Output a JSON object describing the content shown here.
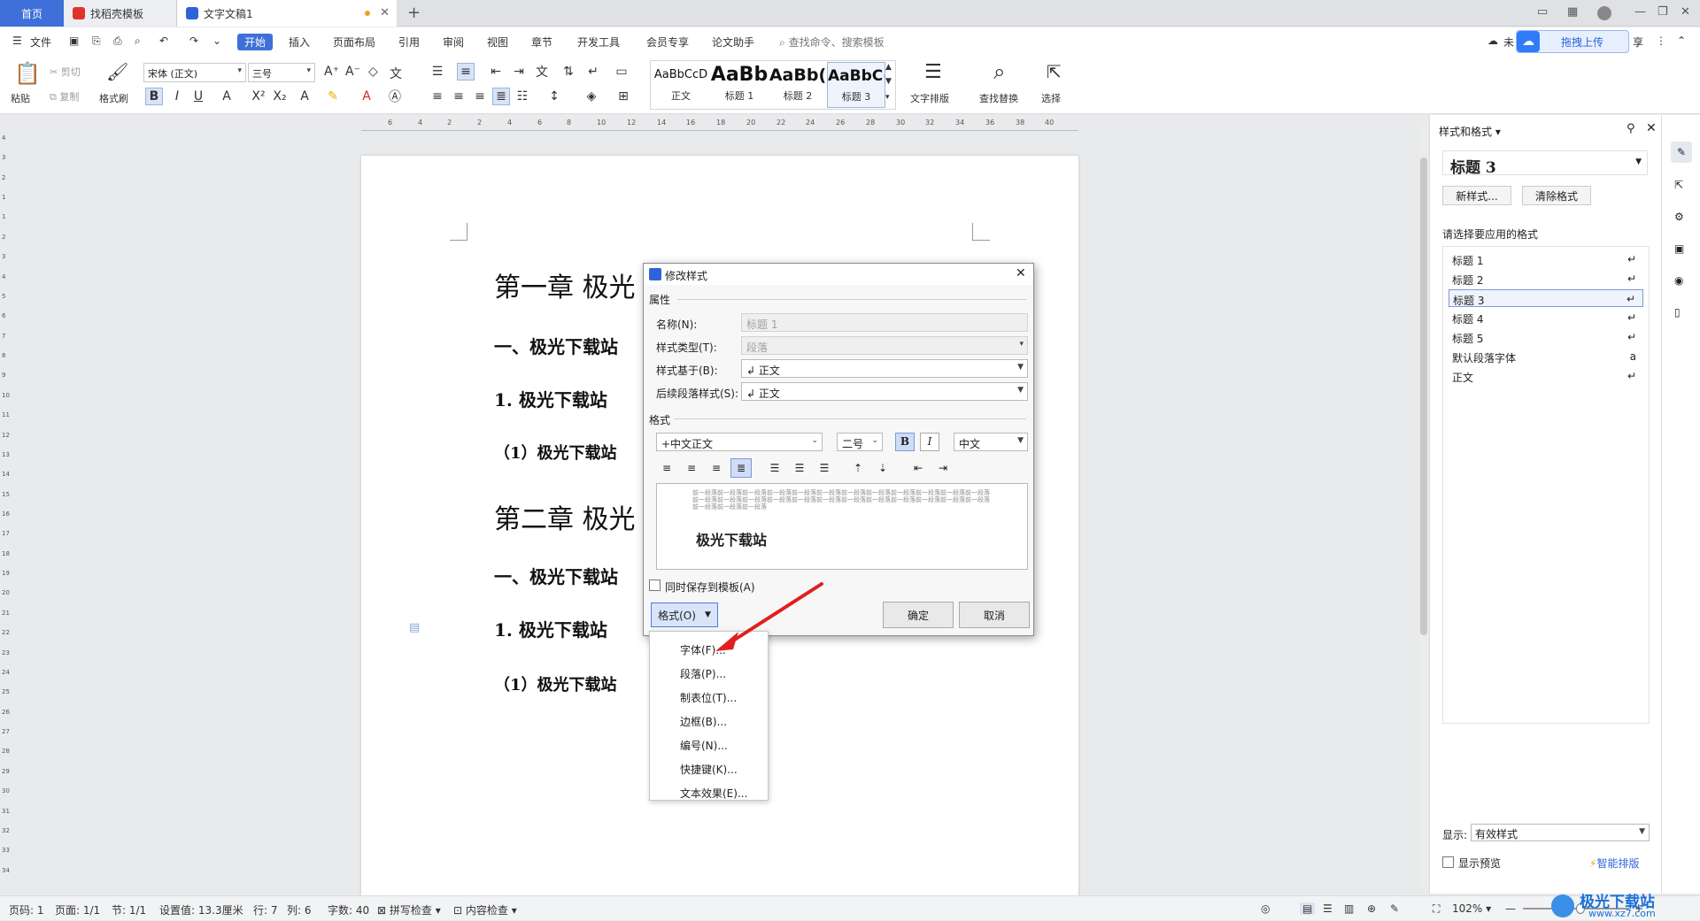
{
  "tabs": {
    "home": "首页",
    "template": "找稻壳模板",
    "document": "文字文稿1",
    "new_tab": "+"
  },
  "menubar": {
    "file": "文件",
    "items": [
      "开始",
      "插入",
      "页面布局",
      "引用",
      "审阅",
      "视图",
      "章节",
      "开发工具",
      "会员专享",
      "论文助手"
    ],
    "search_placeholder": "查找命令、搜索模板",
    "upload": "拖拽上传",
    "sync_partial": "未",
    "share_partial": "享"
  },
  "ribbon": {
    "paste": "粘贴",
    "cut": "剪切",
    "copy": "复制",
    "format_painter": "格式刷",
    "font_name": "宋体 (正文)",
    "font_size": "三号",
    "styles": [
      {
        "preview": "AaBbCcD",
        "label": "正文"
      },
      {
        "preview": "AaBb",
        "label": "标题 1"
      },
      {
        "preview": "AaBb(",
        "label": "标题 2"
      },
      {
        "preview": "AaBbC(",
        "label": "标题 3"
      }
    ],
    "text_layout": "文字排版",
    "find_replace": "查找替换",
    "select": "选择"
  },
  "document": {
    "lines": [
      "第一章  极光",
      "一、极光下载站",
      "1. 极光下载站",
      "（1）极光下载站",
      "第二章  极光",
      "一、极光下载站",
      "1. 极光下载站",
      "（1）极光下载站"
    ]
  },
  "dialog": {
    "title": "修改样式",
    "section_properties": "属性",
    "name_label": "名称(N):",
    "name_value": "标题 1",
    "type_label": "样式类型(T):",
    "type_value": "段落",
    "based_label": "样式基于(B):",
    "based_value": "↲ 正文",
    "next_label": "后续段落样式(S):",
    "next_value": "↲ 正文",
    "section_format": "格式",
    "font_value": "+中文正文",
    "size_value": "二号",
    "bold": "B",
    "italic": "I",
    "lang_value": "中文",
    "preview_filler": "前一段落前一段落前一段落前一段落前一段落前一段落前一段落前一段落前一段落前一段落前一段落前一段落前一段落前一段落前一段落前一段落前一段落前一段落前一段落前一段落前一段落前一段落前一段落前一段落前一段落前一段落前一段落",
    "preview_text": "极光下载站",
    "save_template": "同时保存到模板(A)",
    "format_button": "格式(O)",
    "ok": "确定",
    "cancel": "取消"
  },
  "format_menu": [
    "字体(F)...",
    "段落(P)...",
    "制表位(T)...",
    "边框(B)...",
    "编号(N)...",
    "快捷键(K)...",
    "文本效果(E)..."
  ],
  "side_panel": {
    "title": "样式和格式",
    "current_style": "标题  3",
    "new_style": "新样式...",
    "clear_format": "清除格式",
    "choose_label": "请选择要应用的格式",
    "styles": [
      {
        "name": "标题 1",
        "mark": "↵"
      },
      {
        "name": "标题 2",
        "mark": "↵"
      },
      {
        "name": "标题 3",
        "mark": "↵"
      },
      {
        "name": "标题 4",
        "mark": "↵"
      },
      {
        "name": "标题 5",
        "mark": "↵"
      },
      {
        "name": "默认段落字体",
        "mark": "a"
      },
      {
        "name": "正文",
        "mark": "↵"
      }
    ],
    "show_label": "显示:",
    "show_value": "有效样式",
    "show_preview": "显示预览",
    "smart_layout": "智能排版"
  },
  "status": {
    "page": "页码: 1",
    "pages": "页面: 1/1",
    "section": "节: 1/1",
    "setting": "设置值: 13.3厘米",
    "row": "行: 7",
    "col": "列: 6",
    "words": "字数: 40",
    "spell": "拼写检查",
    "content_check": "内容检查",
    "zoom": "102%",
    "watermark": "极光下载站",
    "watermark_url": "www.xz7.com"
  },
  "ruler": {
    "horizontal": [
      "6",
      "4",
      "2",
      "2",
      "4",
      "6",
      "8",
      "10",
      "12",
      "14",
      "16",
      "18",
      "20",
      "22",
      "24",
      "26",
      "28",
      "30",
      "32",
      "34",
      "36",
      "38",
      "40"
    ],
    "vertical": [
      "4",
      "3",
      "2",
      "1",
      "1",
      "2",
      "3",
      "4",
      "5",
      "6",
      "7",
      "8",
      "9",
      "10",
      "11",
      "12",
      "13",
      "14",
      "15",
      "16",
      "17",
      "18",
      "19",
      "20",
      "21",
      "22",
      "23",
      "24",
      "25",
      "26",
      "27",
      "28",
      "29",
      "30",
      "31",
      "32",
      "33",
      "34"
    ]
  },
  "colors": {
    "accent": "#3f6fd8",
    "arrow": "#e02020"
  }
}
